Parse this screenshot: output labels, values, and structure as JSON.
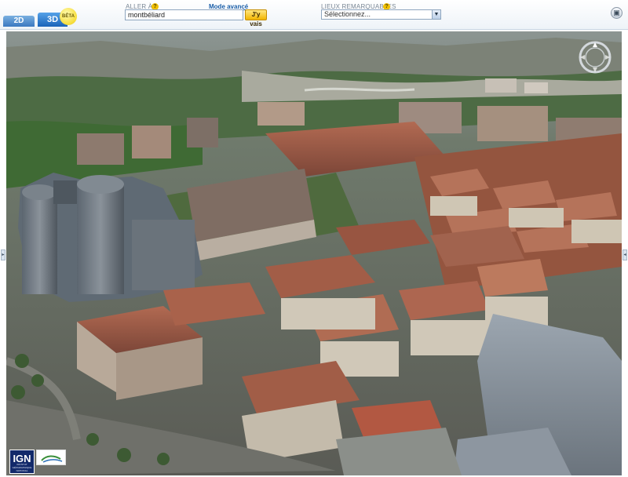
{
  "tabs": {
    "tab_2d": "2D",
    "tab_3d": "3D",
    "beta": "BÊTA"
  },
  "search": {
    "label": "ALLER À",
    "help": "?",
    "advanced_link": "Mode avancé",
    "value": "montbéliard",
    "go_label": "J'y vais"
  },
  "places": {
    "label": "LIEUX REMARQUABLES",
    "help": "?",
    "selected": "Sélectionnez...",
    "arrow": "▼"
  },
  "fullscreen": {
    "icon": "▣"
  },
  "map": {
    "left_handle": "▸",
    "right_handle": "◂"
  },
  "logos": {
    "ign": "IGN",
    "ign_sub": "INSTITUT GÉOGRAPHIQUE NATIONAL"
  },
  "colors": {
    "accent": "#1a63b8",
    "go_button": "#f2b500",
    "beta_badge": "#f6dd3a",
    "roof": "#a4604a",
    "facade": "#c9c2b2",
    "vegetation": "#3f6a34"
  }
}
